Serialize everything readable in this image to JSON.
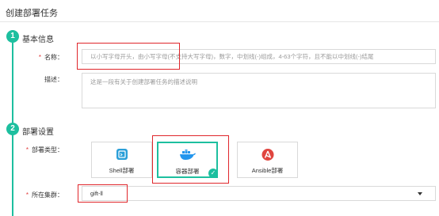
{
  "page": {
    "title": "创建部署任务"
  },
  "steps": [
    {
      "number": "1",
      "title": "基本信息"
    },
    {
      "number": "2",
      "title": "部署设置"
    }
  ],
  "form": {
    "name": {
      "label": "名称：",
      "required": "*",
      "value": "",
      "placeholder": "以小写字母开头，由小写字母(不支持大写字母)，数字，中划线(-)组成，4-63个字符，且不能以中划线(-)结尾"
    },
    "description": {
      "label": "描述：",
      "value": "",
      "placeholder": "这是一段有关于创建部署任务的描述说明"
    },
    "deploy_type": {
      "label": "部署类型：",
      "required": "*",
      "options": [
        {
          "label": "Shell部署",
          "icon": "shell-icon",
          "selected": false
        },
        {
          "label": "容器部署",
          "icon": "docker-whale-icon",
          "selected": true
        },
        {
          "label": "Ansible部署",
          "icon": "ansible-icon",
          "selected": false
        }
      ]
    },
    "cluster": {
      "label": "所在集群：",
      "required": "*",
      "value": "gift-ll"
    }
  },
  "colors": {
    "accent": "#1dbf9f",
    "required": "#e23c3c",
    "highlight": "#e0262b",
    "docker": "#2496ed",
    "ansible": "#e0453f"
  }
}
